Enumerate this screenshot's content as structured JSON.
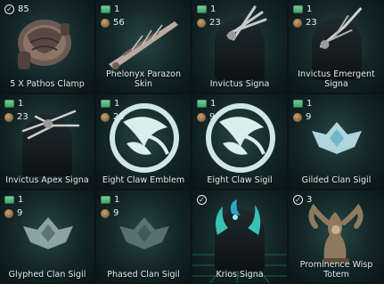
{
  "tiles": [
    {
      "label": "5 X Pathos Clamp",
      "badges": {
        "count": "85"
      }
    },
    {
      "label": "Phelonyx Parazon Skin",
      "badges": {
        "plat": "1",
        "credits": "56"
      }
    },
    {
      "label": "Invictus Signa",
      "badges": {
        "plat": "1",
        "credits": "23"
      }
    },
    {
      "label": "Invictus Emergent Signa",
      "badges": {
        "plat": "1",
        "credits": "23"
      }
    },
    {
      "label": "Invictus Apex Signa",
      "badges": {
        "plat": "1",
        "credits": "23"
      }
    },
    {
      "label": "Eight Claw Emblem",
      "badges": {
        "plat": "1",
        "credits": "25"
      }
    },
    {
      "label": "Eight Claw Sigil",
      "badges": {
        "plat": "1",
        "credits": "9"
      }
    },
    {
      "label": "Gilded Clan Sigil",
      "badges": {
        "plat": "1",
        "credits": "9"
      }
    },
    {
      "label": "Glyphed Clan Sigil",
      "badges": {
        "plat": "1",
        "credits": "9"
      }
    },
    {
      "label": "Phased Clan Sigil",
      "badges": {
        "plat": "1",
        "credits": "9"
      }
    },
    {
      "label": "Krios Signa",
      "badges": {}
    },
    {
      "label": "Prominence Wisp Totem",
      "badges": {
        "count": "3"
      }
    }
  ],
  "icons": {
    "money": "platinum-icon",
    "credits": "credits-icon",
    "owned": "owned-check-icon"
  },
  "colors": {
    "accent": "#6fc6b3",
    "background": "#0c1416",
    "text": "#e6efee"
  }
}
